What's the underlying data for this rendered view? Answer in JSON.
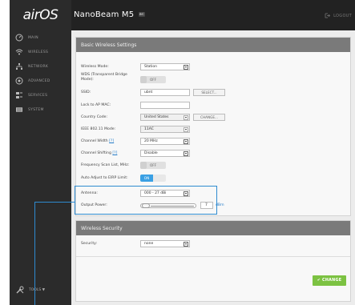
{
  "app": {
    "logo": "airOS",
    "product": "NanoBeam M5",
    "product_badge": "ac"
  },
  "topbar": {
    "logout_label": "LOGOUT"
  },
  "sidebar": {
    "items": [
      {
        "label": "MAIN",
        "icon": "main-icon"
      },
      {
        "label": "WIRELESS",
        "icon": "wifi-icon"
      },
      {
        "label": "NETWORK",
        "icon": "network-icon"
      },
      {
        "label": "ADVANCED",
        "icon": "advanced-icon"
      },
      {
        "label": "SERVICES",
        "icon": "services-icon"
      },
      {
        "label": "SYSTEM",
        "icon": "system-icon"
      }
    ],
    "tools_label": "TOOLS ▼"
  },
  "basic": {
    "title": "Basic Wireless Settings",
    "wireless_mode": {
      "label": "Wireless Mode:",
      "value": "Station"
    },
    "wds": {
      "label": "WDS (Transparent Bridge Mode):",
      "state": "OFF"
    },
    "ssid": {
      "label": "SSID:",
      "value": "ubnt",
      "button": "SELECT..."
    },
    "lock_ap": {
      "label": "Lock to AP MAC:",
      "value": ""
    },
    "country": {
      "label": "Country Code:",
      "value": "United States",
      "button": "CHANGE..."
    },
    "ieee": {
      "label": "IEEE 802.11 Mode:",
      "value": "11AC"
    },
    "channel_width": {
      "label": "Channel Width",
      "hint": "[?]",
      "value": "20 MHz"
    },
    "channel_shifting": {
      "label": "Channel Shifting",
      "hint": "[?]",
      "value": "Disable"
    },
    "freq_scan": {
      "label": "Frequency Scan List, MHz:",
      "state": "OFF"
    },
    "auto_eirp": {
      "label": "Auto Adjust to EIRP Limit:",
      "state": "ON"
    },
    "antenna": {
      "label": "Antenna:",
      "value": "000 - 27 dBi"
    },
    "output_power": {
      "label": "Output Power:",
      "value": "7",
      "unit": "dBm"
    }
  },
  "security": {
    "title": "Wireless Security",
    "label": "Security:",
    "value": "none"
  },
  "change_button": "✔ CHANGE"
}
